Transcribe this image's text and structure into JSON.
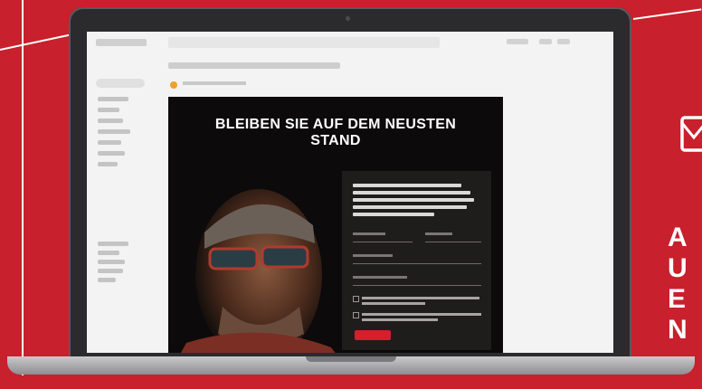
{
  "newsletter": {
    "headline": "BLEIBEN SIE AUF DEM NEUSTEN\nSTAND"
  },
  "promo": {
    "lines": [
      "A",
      "U",
      "E",
      "N"
    ]
  },
  "icons": {
    "envelope": "envelope-icon"
  },
  "colors": {
    "background": "#c8202c",
    "newsletter_bg": "#0c0a0a",
    "button": "#d4202c"
  }
}
